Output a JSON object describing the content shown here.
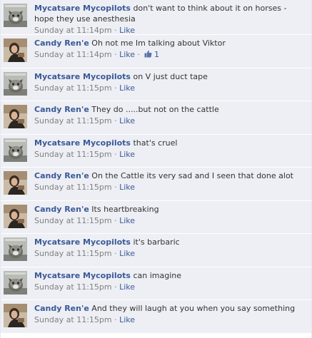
{
  "comments": [
    {
      "author": "Mycatsare Mycopilots",
      "avatar": "cat-avatar",
      "text": "don't want to think about it on horses - hope they use anesthesia",
      "time": "Sunday at 11:14pm",
      "like": "Like",
      "likes": ""
    },
    {
      "author": "Candy Ren'e",
      "avatar": "woman-avatar",
      "text": "Oh not me Im talking about Viktor",
      "time": "Sunday at 11:14pm",
      "like": "Like",
      "likes": "1"
    },
    {
      "author": "Mycatsare Mycopilots",
      "avatar": "cat-avatar",
      "text": "on V just duct tape",
      "time": "Sunday at 11:15pm",
      "like": "Like",
      "likes": ""
    },
    {
      "author": "Candy Ren'e",
      "avatar": "woman-avatar",
      "text": "They do .....but not on the cattle",
      "time": "Sunday at 11:15pm",
      "like": "Like",
      "likes": ""
    },
    {
      "author": "Mycatsare Mycopilots",
      "avatar": "cat-avatar",
      "text": "that's cruel",
      "time": "Sunday at 11:15pm",
      "like": "Like",
      "likes": ""
    },
    {
      "author": "Candy Ren'e",
      "avatar": "woman-avatar",
      "text": "On the Cattle its very sad and I seen that done alot",
      "time": "Sunday at 11:15pm",
      "like": "Like",
      "likes": ""
    },
    {
      "author": "Candy Ren'e",
      "avatar": "woman-avatar",
      "text": "Its heartbreaking",
      "time": "Sunday at 11:15pm",
      "like": "Like",
      "likes": ""
    },
    {
      "author": "Mycatsare Mycopilots",
      "avatar": "cat-avatar",
      "text": "it's barbaric",
      "time": "Sunday at 11:15pm",
      "like": "Like",
      "likes": ""
    },
    {
      "author": "Mycatsare Mycopilots",
      "avatar": "cat-avatar",
      "text": "can imagine",
      "time": "Sunday at 11:15pm",
      "like": "Like",
      "likes": ""
    },
    {
      "author": "Candy Ren'e",
      "avatar": "woman-avatar",
      "text": "And they will laugh at you when you say something",
      "time": "Sunday at 11:15pm",
      "like": "Like",
      "likes": ""
    }
  ],
  "separator": "·"
}
